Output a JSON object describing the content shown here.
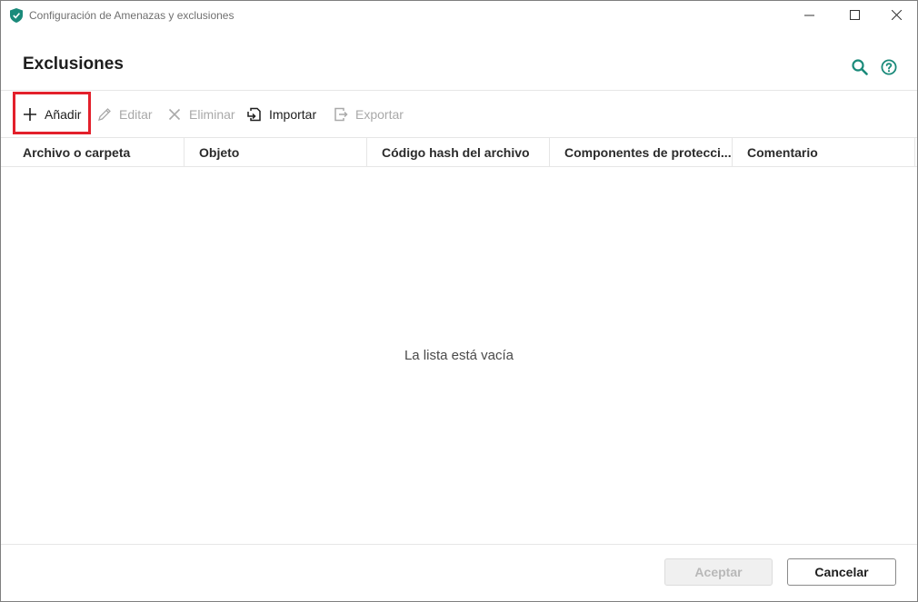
{
  "window": {
    "title": "Configuración de Amenazas y exclusiones"
  },
  "header": {
    "title": "Exclusiones"
  },
  "toolbar": {
    "add_label": "Añadir",
    "edit_label": "Editar",
    "delete_label": "Eliminar",
    "import_label": "Importar",
    "export_label": "Exportar"
  },
  "table": {
    "columns": [
      "Archivo o carpeta",
      "Objeto",
      "Código hash del archivo",
      "Componentes de protecci...",
      "Comentario"
    ],
    "empty_message": "La lista está vacía"
  },
  "footer": {
    "ok_label": "Aceptar",
    "cancel_label": "Cancelar"
  },
  "colors": {
    "accent": "#1a8a7a",
    "highlight": "#e3202b",
    "disabled_text": "#a9a9a9"
  }
}
